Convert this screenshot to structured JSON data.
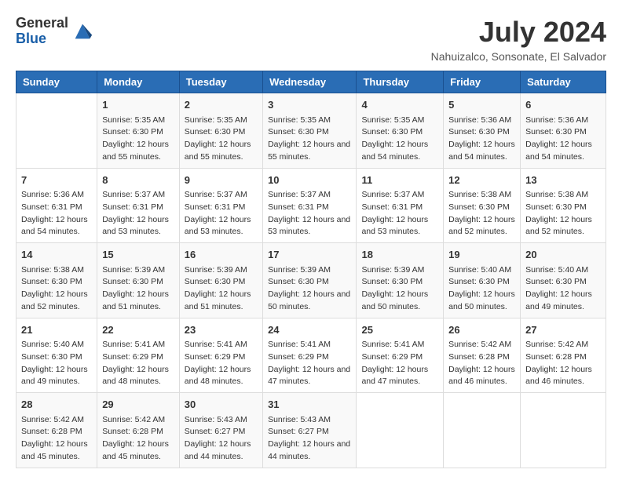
{
  "header": {
    "logo_general": "General",
    "logo_blue": "Blue",
    "month_year": "July 2024",
    "location": "Nahuizalco, Sonsonate, El Salvador"
  },
  "weekdays": [
    "Sunday",
    "Monday",
    "Tuesday",
    "Wednesday",
    "Thursday",
    "Friday",
    "Saturday"
  ],
  "weeks": [
    [
      {
        "day": "",
        "sunrise": "",
        "sunset": "",
        "daylight": ""
      },
      {
        "day": "1",
        "sunrise": "Sunrise: 5:35 AM",
        "sunset": "Sunset: 6:30 PM",
        "daylight": "Daylight: 12 hours and 55 minutes."
      },
      {
        "day": "2",
        "sunrise": "Sunrise: 5:35 AM",
        "sunset": "Sunset: 6:30 PM",
        "daylight": "Daylight: 12 hours and 55 minutes."
      },
      {
        "day": "3",
        "sunrise": "Sunrise: 5:35 AM",
        "sunset": "Sunset: 6:30 PM",
        "daylight": "Daylight: 12 hours and 55 minutes."
      },
      {
        "day": "4",
        "sunrise": "Sunrise: 5:35 AM",
        "sunset": "Sunset: 6:30 PM",
        "daylight": "Daylight: 12 hours and 54 minutes."
      },
      {
        "day": "5",
        "sunrise": "Sunrise: 5:36 AM",
        "sunset": "Sunset: 6:30 PM",
        "daylight": "Daylight: 12 hours and 54 minutes."
      },
      {
        "day": "6",
        "sunrise": "Sunrise: 5:36 AM",
        "sunset": "Sunset: 6:30 PM",
        "daylight": "Daylight: 12 hours and 54 minutes."
      }
    ],
    [
      {
        "day": "7",
        "sunrise": "Sunrise: 5:36 AM",
        "sunset": "Sunset: 6:31 PM",
        "daylight": "Daylight: 12 hours and 54 minutes."
      },
      {
        "day": "8",
        "sunrise": "Sunrise: 5:37 AM",
        "sunset": "Sunset: 6:31 PM",
        "daylight": "Daylight: 12 hours and 53 minutes."
      },
      {
        "day": "9",
        "sunrise": "Sunrise: 5:37 AM",
        "sunset": "Sunset: 6:31 PM",
        "daylight": "Daylight: 12 hours and 53 minutes."
      },
      {
        "day": "10",
        "sunrise": "Sunrise: 5:37 AM",
        "sunset": "Sunset: 6:31 PM",
        "daylight": "Daylight: 12 hours and 53 minutes."
      },
      {
        "day": "11",
        "sunrise": "Sunrise: 5:37 AM",
        "sunset": "Sunset: 6:31 PM",
        "daylight": "Daylight: 12 hours and 53 minutes."
      },
      {
        "day": "12",
        "sunrise": "Sunrise: 5:38 AM",
        "sunset": "Sunset: 6:30 PM",
        "daylight": "Daylight: 12 hours and 52 minutes."
      },
      {
        "day": "13",
        "sunrise": "Sunrise: 5:38 AM",
        "sunset": "Sunset: 6:30 PM",
        "daylight": "Daylight: 12 hours and 52 minutes."
      }
    ],
    [
      {
        "day": "14",
        "sunrise": "Sunrise: 5:38 AM",
        "sunset": "Sunset: 6:30 PM",
        "daylight": "Daylight: 12 hours and 52 minutes."
      },
      {
        "day": "15",
        "sunrise": "Sunrise: 5:39 AM",
        "sunset": "Sunset: 6:30 PM",
        "daylight": "Daylight: 12 hours and 51 minutes."
      },
      {
        "day": "16",
        "sunrise": "Sunrise: 5:39 AM",
        "sunset": "Sunset: 6:30 PM",
        "daylight": "Daylight: 12 hours and 51 minutes."
      },
      {
        "day": "17",
        "sunrise": "Sunrise: 5:39 AM",
        "sunset": "Sunset: 6:30 PM",
        "daylight": "Daylight: 12 hours and 50 minutes."
      },
      {
        "day": "18",
        "sunrise": "Sunrise: 5:39 AM",
        "sunset": "Sunset: 6:30 PM",
        "daylight": "Daylight: 12 hours and 50 minutes."
      },
      {
        "day": "19",
        "sunrise": "Sunrise: 5:40 AM",
        "sunset": "Sunset: 6:30 PM",
        "daylight": "Daylight: 12 hours and 50 minutes."
      },
      {
        "day": "20",
        "sunrise": "Sunrise: 5:40 AM",
        "sunset": "Sunset: 6:30 PM",
        "daylight": "Daylight: 12 hours and 49 minutes."
      }
    ],
    [
      {
        "day": "21",
        "sunrise": "Sunrise: 5:40 AM",
        "sunset": "Sunset: 6:30 PM",
        "daylight": "Daylight: 12 hours and 49 minutes."
      },
      {
        "day": "22",
        "sunrise": "Sunrise: 5:41 AM",
        "sunset": "Sunset: 6:29 PM",
        "daylight": "Daylight: 12 hours and 48 minutes."
      },
      {
        "day": "23",
        "sunrise": "Sunrise: 5:41 AM",
        "sunset": "Sunset: 6:29 PM",
        "daylight": "Daylight: 12 hours and 48 minutes."
      },
      {
        "day": "24",
        "sunrise": "Sunrise: 5:41 AM",
        "sunset": "Sunset: 6:29 PM",
        "daylight": "Daylight: 12 hours and 47 minutes."
      },
      {
        "day": "25",
        "sunrise": "Sunrise: 5:41 AM",
        "sunset": "Sunset: 6:29 PM",
        "daylight": "Daylight: 12 hours and 47 minutes."
      },
      {
        "day": "26",
        "sunrise": "Sunrise: 5:42 AM",
        "sunset": "Sunset: 6:28 PM",
        "daylight": "Daylight: 12 hours and 46 minutes."
      },
      {
        "day": "27",
        "sunrise": "Sunrise: 5:42 AM",
        "sunset": "Sunset: 6:28 PM",
        "daylight": "Daylight: 12 hours and 46 minutes."
      }
    ],
    [
      {
        "day": "28",
        "sunrise": "Sunrise: 5:42 AM",
        "sunset": "Sunset: 6:28 PM",
        "daylight": "Daylight: 12 hours and 45 minutes."
      },
      {
        "day": "29",
        "sunrise": "Sunrise: 5:42 AM",
        "sunset": "Sunset: 6:28 PM",
        "daylight": "Daylight: 12 hours and 45 minutes."
      },
      {
        "day": "30",
        "sunrise": "Sunrise: 5:43 AM",
        "sunset": "Sunset: 6:27 PM",
        "daylight": "Daylight: 12 hours and 44 minutes."
      },
      {
        "day": "31",
        "sunrise": "Sunrise: 5:43 AM",
        "sunset": "Sunset: 6:27 PM",
        "daylight": "Daylight: 12 hours and 44 minutes."
      },
      {
        "day": "",
        "sunrise": "",
        "sunset": "",
        "daylight": ""
      },
      {
        "day": "",
        "sunrise": "",
        "sunset": "",
        "daylight": ""
      },
      {
        "day": "",
        "sunrise": "",
        "sunset": "",
        "daylight": ""
      }
    ]
  ]
}
